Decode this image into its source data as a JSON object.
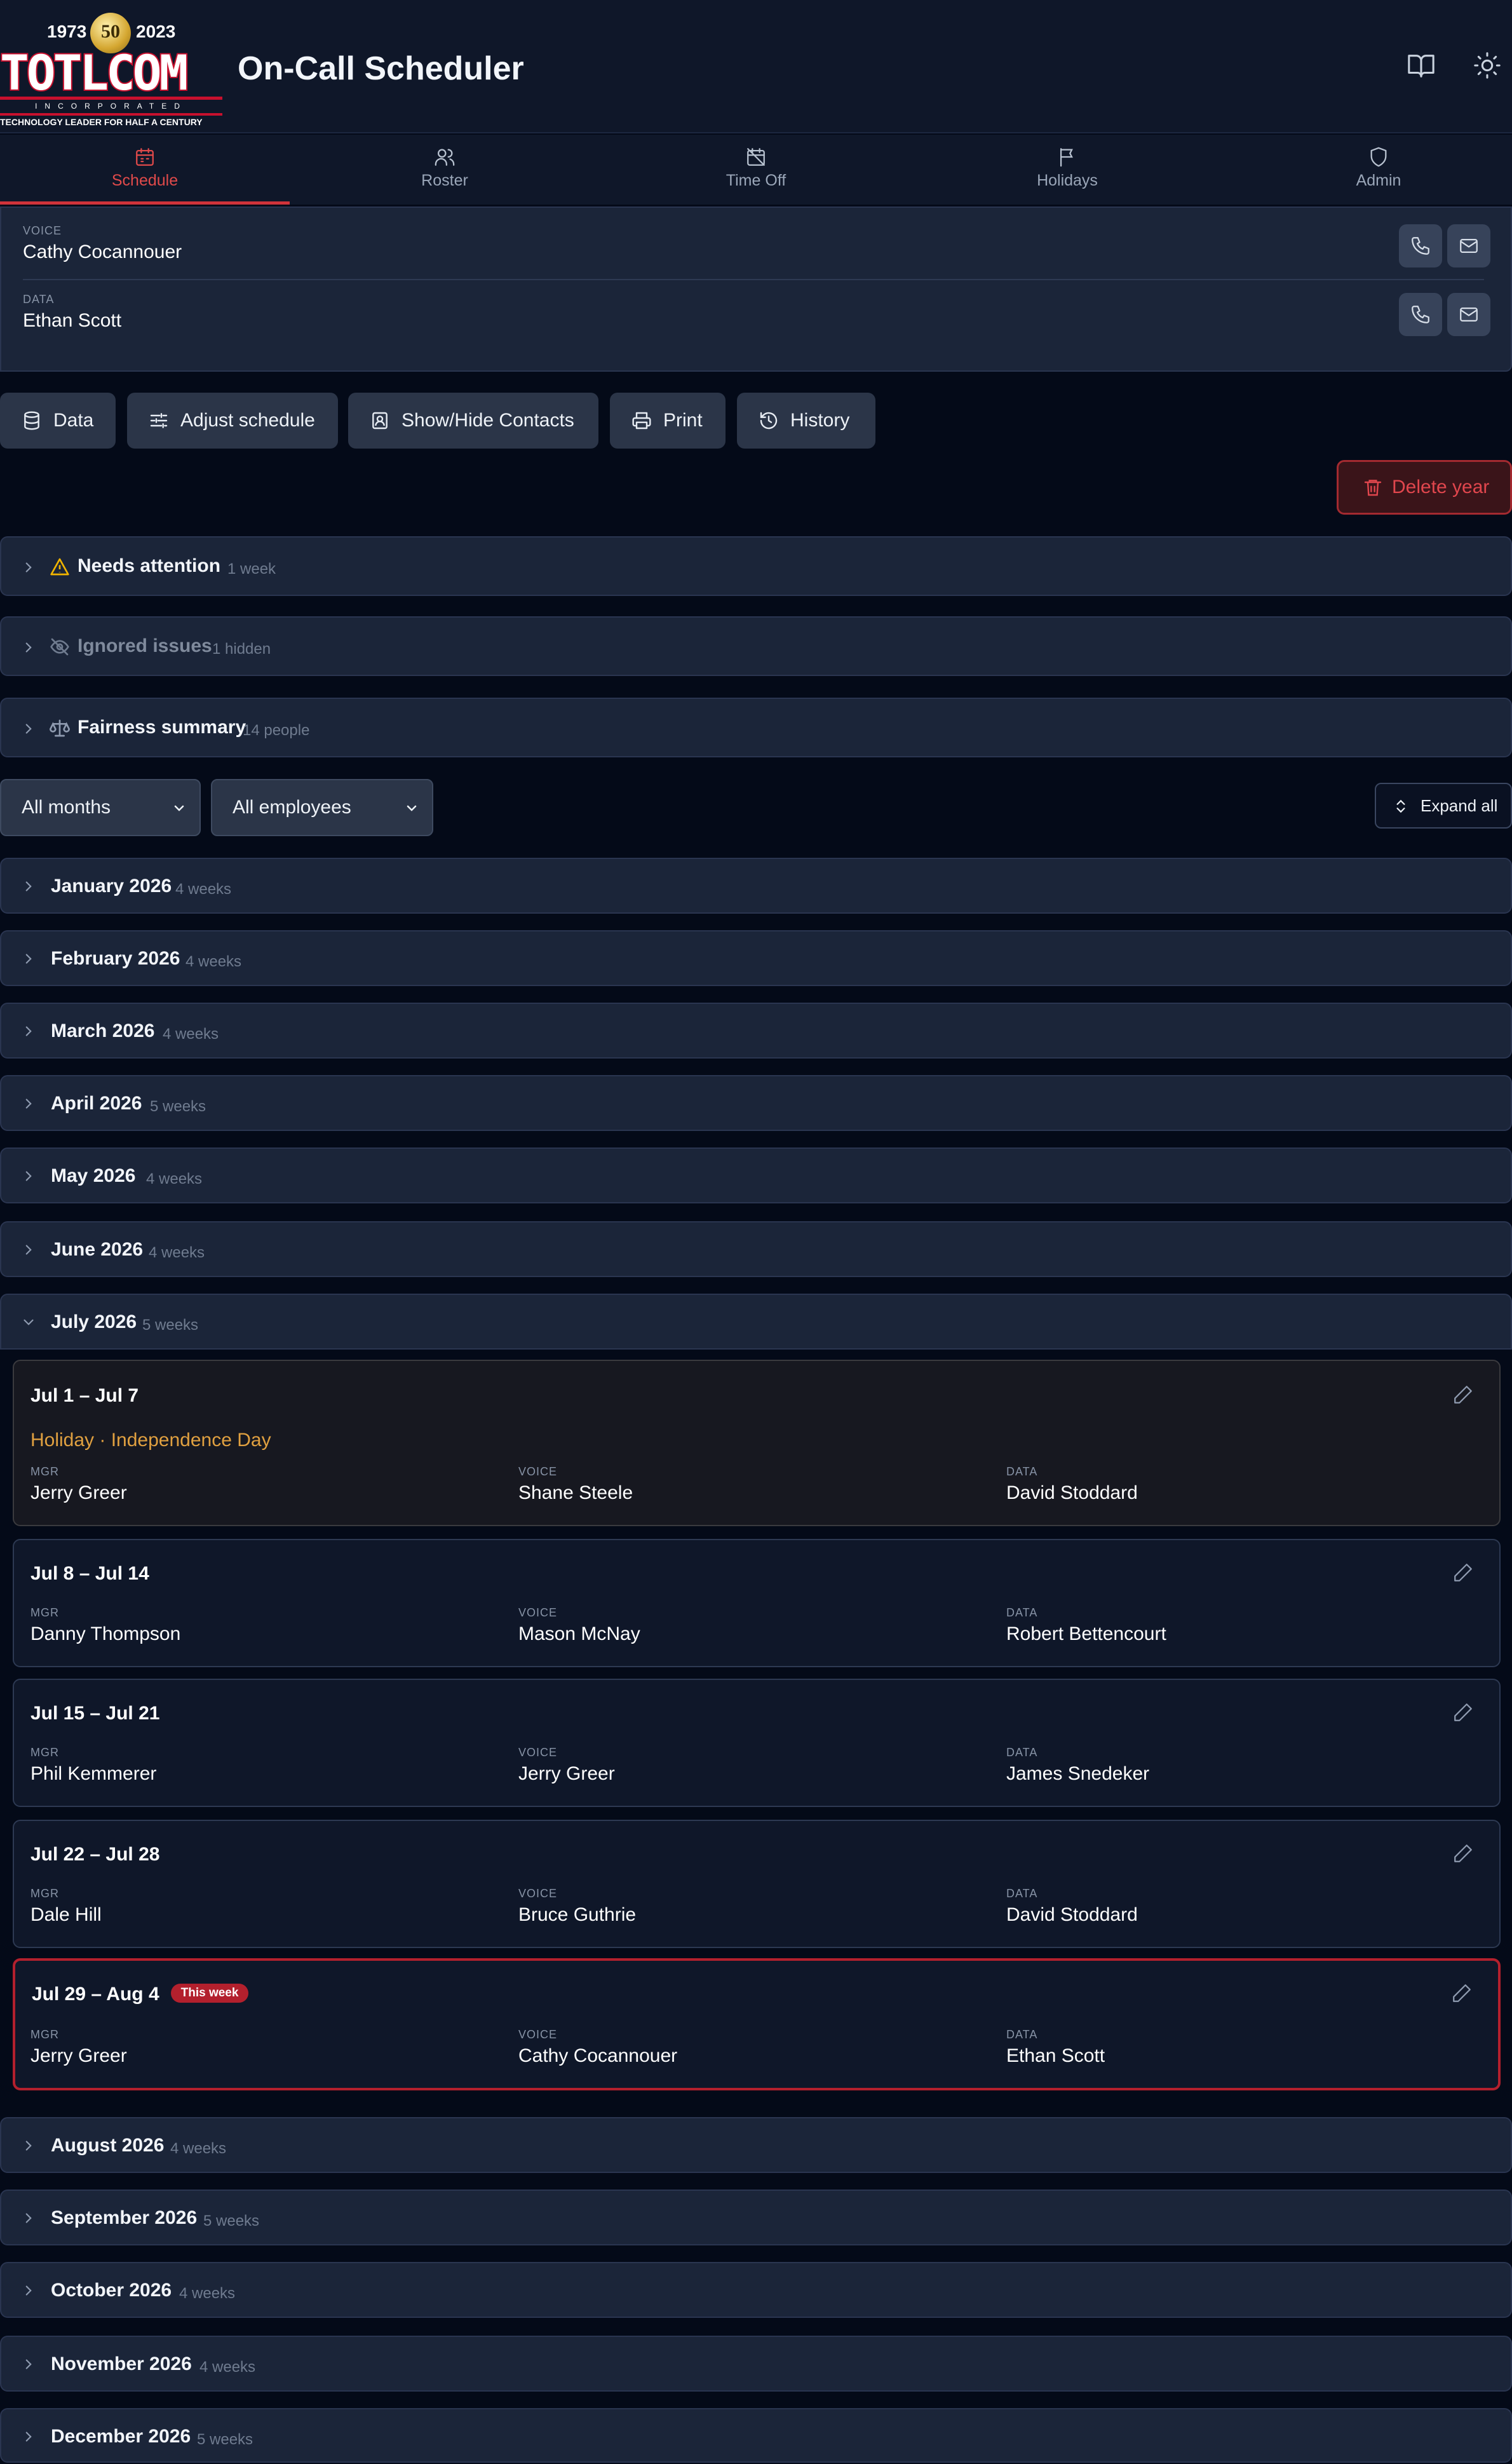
{
  "app": {
    "logo": {
      "year_start": "1973",
      "year_end": "2023",
      "medal": "50",
      "wordmark": "TOTLCOM",
      "incorporated": "INCORPORATED",
      "tagline": "TECHNOLOGY LEADER FOR HALF A CENTURY"
    },
    "title": "On-Call Scheduler"
  },
  "header_icons": [
    "book-icon",
    "sun-icon"
  ],
  "tabs": [
    {
      "label": "Schedule",
      "icon": "calendar-icon",
      "active": true
    },
    {
      "label": "Roster",
      "icon": "users-icon",
      "active": false
    },
    {
      "label": "Time Off",
      "icon": "calendar-off-icon",
      "active": false
    },
    {
      "label": "Holidays",
      "icon": "flag-icon",
      "active": false
    },
    {
      "label": "Admin",
      "icon": "shield-icon",
      "active": false
    }
  ],
  "current_contacts": [
    {
      "role": "VOICE",
      "name": "Cathy Cocannouer"
    },
    {
      "role": "DATA",
      "name": "Ethan Scott"
    }
  ],
  "toolbar": {
    "data": "Data",
    "adjust": "Adjust schedule",
    "contacts": "Show/Hide Contacts",
    "print": "Print",
    "history": "History",
    "delete_year": "Delete year"
  },
  "panels": [
    {
      "title": "Needs attention",
      "count": "1 week"
    },
    {
      "title": "Ignored issues",
      "count": "1 hidden"
    },
    {
      "title": "Fairness summary",
      "count": "14 people"
    }
  ],
  "filters": {
    "months": "All months",
    "employees": "All employees",
    "expand_all": "Expand all"
  },
  "months_before": [
    {
      "name": "January 2026",
      "count": "4 weeks"
    },
    {
      "name": "February 2026",
      "count": "4 weeks"
    },
    {
      "name": "March 2026",
      "count": "4 weeks"
    },
    {
      "name": "April 2026",
      "count": "5 weeks"
    },
    {
      "name": "May 2026",
      "count": "4 weeks"
    },
    {
      "name": "June 2026",
      "count": "4 weeks"
    }
  ],
  "july": {
    "name": "July 2026",
    "count": "5 weeks",
    "labels": {
      "mgr": "MGR",
      "voice": "VOICE",
      "data": "DATA"
    },
    "weeks": [
      {
        "range": "Jul 1 – Jul 7",
        "holiday": "Holiday · Independence Day",
        "mgr": "Jerry Greer",
        "voice": "Shane Steele",
        "data": "David Stoddard"
      },
      {
        "range": "Jul 8 – Jul 14",
        "mgr": "Danny Thompson",
        "voice": "Mason McNay",
        "data": "Robert Bettencourt"
      },
      {
        "range": "Jul 15 – Jul 21",
        "mgr": "Phil Kemmerer",
        "voice": "Jerry Greer",
        "data": "James Snedeker"
      },
      {
        "range": "Jul 22 – Jul 28",
        "mgr": "Dale Hill",
        "voice": "Bruce Guthrie",
        "data": "David Stoddard"
      },
      {
        "range": "Jul 29 – Aug 4",
        "badge": "This week",
        "mgr": "Jerry Greer",
        "voice": "Cathy Cocannouer",
        "data": "Ethan Scott"
      }
    ]
  },
  "months_after": [
    {
      "name": "August 2026",
      "count": "4 weeks"
    },
    {
      "name": "September 2026",
      "count": "5 weeks"
    },
    {
      "name": "October 2026",
      "count": "4 weeks"
    },
    {
      "name": "November 2026",
      "count": "4 weeks"
    },
    {
      "name": "December 2026",
      "count": "5 weeks"
    }
  ]
}
